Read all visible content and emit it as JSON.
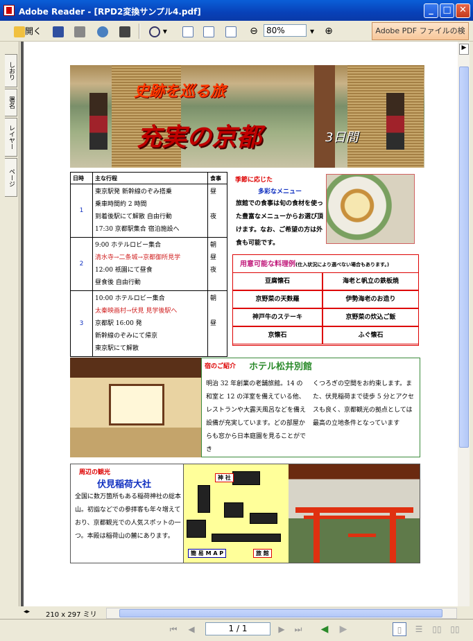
{
  "window": {
    "title": "Adobe Reader - [RPD2変換サンプル4.pdf]",
    "minimize": "_",
    "maximize": "□",
    "close": "✕"
  },
  "toolbar": {
    "open_label": "開く",
    "zoom_value": "80%",
    "search_button": "Adobe PDF ファイルの検索"
  },
  "nav_tabs": [
    "しおり",
    "署名",
    "レイヤー",
    "ページ"
  ],
  "status": {
    "page_size": "210 x 297 ミリ",
    "page_indicator": "1 / 1"
  },
  "banner": {
    "subtitle": "史跡を巡る旅",
    "title": "充実の京都",
    "duration": "3日間"
  },
  "itinerary": {
    "headers": [
      "日時",
      "主な行程",
      "食事"
    ],
    "days": [
      {
        "num": "1",
        "lines": [
          "東京駅発 新幹線のぞみ搭乗",
          "乗車時間約 2 時間",
          "到着後駅にて解散 自由行動",
          "17:30 京都駅集合 宿泊施設へ"
        ],
        "meals": [
          "昼",
          "",
          "夜",
          ""
        ]
      },
      {
        "num": "2",
        "lines": [
          "9:00 ホテルロビー集合",
          "清水寺→二条城→京都御所見学",
          "12:00 祇園にて昼食",
          "昼食後 自由行動"
        ],
        "meals": [
          "朝",
          "昼",
          "夜",
          ""
        ]
      },
      {
        "num": "3",
        "lines": [
          "10:00 ホテルロビー集合",
          "太秦映画村→伏見 見学後駅へ",
          "京都駅 16:00 発",
          "新幹線のぞみにて帰京",
          "東京駅にて解散"
        ],
        "meals": [
          "朝",
          "",
          "昼",
          "",
          ""
        ]
      }
    ]
  },
  "meal": {
    "title": "季節に応じた",
    "subtitle": "多彩なメニュー",
    "text": "旅館での食事は旬の食材を使った豊富なメニューからお選び頂けます。なお、ご希望の方は外食も可能です。"
  },
  "menu": {
    "title": "用意可能な料理例",
    "note": "(仕入状況により選べない場合もあります。)",
    "items": [
      "豆腐懐石",
      "海老と帆立の鉄板焼",
      "京野菜の天麩羅",
      "伊勢海老のお造り",
      "神戸牛のステーキ",
      "京野菜の炊込ご飯",
      "京懐石",
      "ふぐ懐石"
    ]
  },
  "hotel": {
    "label": "宿のご紹介",
    "name": "ホテル松井別館",
    "text_left": "明治 32 年創業の老舗旅館。14 の和室と 12 の洋室を備えている他、レストランや大露天風呂などを備え設備が充実しています。どの部屋からも窓から日本庭園を見ることができ",
    "text_right": "くつろぎの空間をお約束します。また、伏見稲荷まで徒歩 5 分とアクセスも良く、京都観光の拠点としては最高の立地条件となっています"
  },
  "sightseeing": {
    "label": "周辺の観光",
    "name": "伏見稲荷大社",
    "text": "全国に数万箇所もある稲荷神社の総本山。初詣などでの参拝客も年々増えており、京都観光での人気スポットの一つ。本殿は稲荷山の麓にあります。",
    "map_labels": [
      "神 社",
      "簡 易 M A P",
      "旅 館"
    ]
  }
}
